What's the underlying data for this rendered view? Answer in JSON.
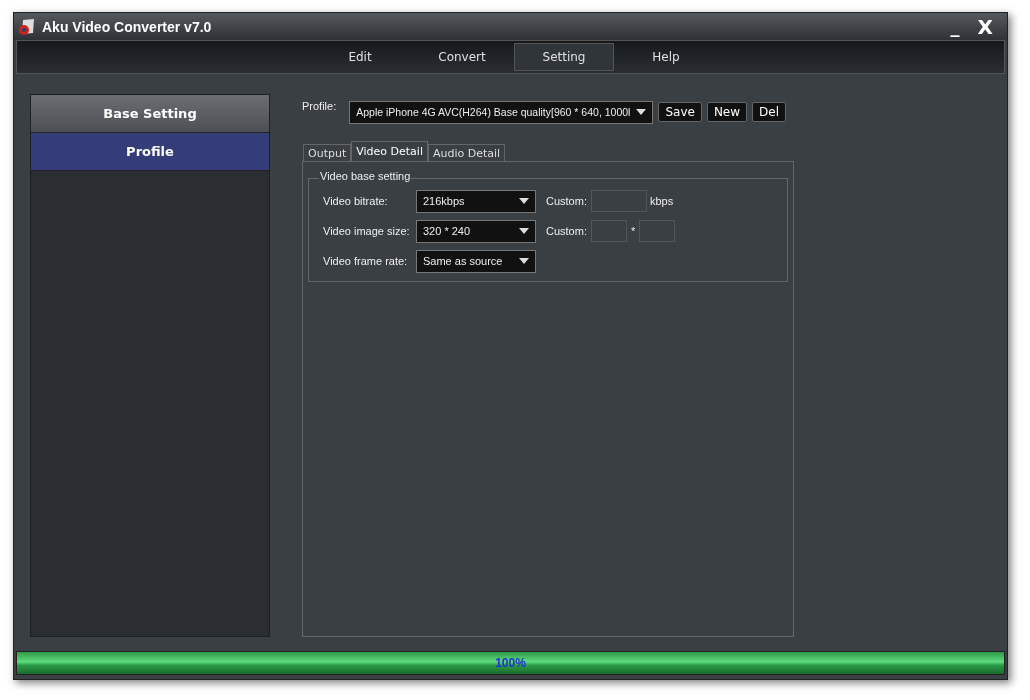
{
  "window": {
    "title": "Aku Video Converter v7.0",
    "minimize": "_",
    "close": "X"
  },
  "menu": [
    {
      "label": "Edit",
      "selected": false
    },
    {
      "label": "Convert",
      "selected": false
    },
    {
      "label": "Setting",
      "selected": true
    },
    {
      "label": "Help",
      "selected": false
    }
  ],
  "sidebar": {
    "items": [
      {
        "label": "Base Setting",
        "selected": false
      },
      {
        "label": "Profile",
        "selected": true
      }
    ]
  },
  "profile": {
    "label": "Profile:",
    "value": "Apple iPhone 4G AVC(H264) Base quality[960 * 640, 1000l",
    "buttons": [
      "Save",
      "New",
      "Del"
    ]
  },
  "tabs": [
    {
      "label": "Output",
      "selected": false
    },
    {
      "label": "Video Detail",
      "selected": true
    },
    {
      "label": "Audio Detail",
      "selected": false
    }
  ],
  "group": {
    "title": "Video base setting",
    "rows": [
      {
        "label": "Video bitrate:",
        "value": "216kbps",
        "kind": "single",
        "custom_label": "Custom:",
        "unit": "kbps"
      },
      {
        "label": "Video image size:",
        "value": "320 * 240",
        "kind": "pair",
        "custom_label": "Custom:",
        "separator": "*"
      },
      {
        "label": "Video frame rate:",
        "value": "Same as source",
        "kind": "none"
      }
    ]
  },
  "progress": {
    "level": 1,
    "text": "100%"
  }
}
